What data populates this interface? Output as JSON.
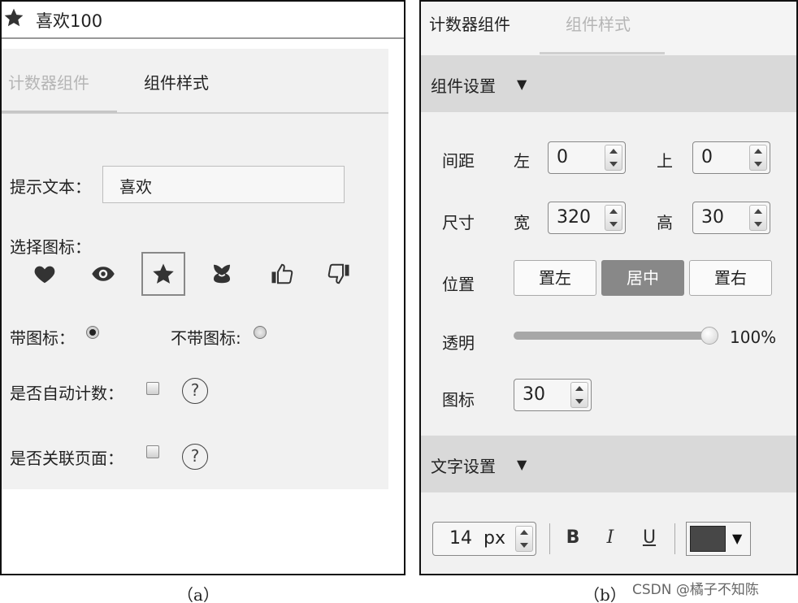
{
  "panel_a": {
    "header": {
      "title": "喜欢100",
      "icon": "star-icon"
    },
    "tabs": [
      {
        "label": "计数器组件",
        "active": true
      },
      {
        "label": "组件样式",
        "active": false
      }
    ],
    "prompt_text": {
      "label": "提示文本：",
      "value": "喜欢"
    },
    "choose_icon": {
      "label": "选择图标：",
      "icons": [
        "heart-icon",
        "eye-icon",
        "star-icon",
        "flower-icon",
        "thumbs-up-icon",
        "thumbs-down-icon"
      ],
      "selected": "star-icon"
    },
    "with_icon": {
      "label": "带图标：",
      "checked": true
    },
    "without_icon": {
      "label": "不带图标:",
      "checked": false
    },
    "auto_count": {
      "label": "是否自动计数：",
      "help": "?"
    },
    "link_page": {
      "label": "是否关联页面：",
      "help": "?"
    }
  },
  "panel_b": {
    "tabs": [
      {
        "label": "计数器组件",
        "active": false
      },
      {
        "label": "组件样式",
        "active": true
      }
    ],
    "component_settings": {
      "title": "组件设置",
      "arrow": "▼",
      "spacing": {
        "label": "间距",
        "left_label": "左",
        "left_value": "0",
        "top_label": "上",
        "top_value": "0"
      },
      "size": {
        "label": "尺寸",
        "width_label": "宽",
        "width_value": "320",
        "height_label": "高",
        "height_value": "30"
      },
      "position": {
        "label": "位置",
        "options": [
          "置左",
          "居中",
          "置右"
        ],
        "selected": "居中"
      },
      "opacity": {
        "label": "透明",
        "value_text": "100%",
        "value": 1.0
      },
      "icon_size": {
        "label": "图标",
        "value": "30"
      }
    },
    "text_settings": {
      "title": "文字设置",
      "arrow": "▼",
      "font_size_value": "14",
      "font_size_unit": "px",
      "bold": "B",
      "italic": "I",
      "underline": "U",
      "color": "#474747",
      "dropdown_arrow": "▼"
    }
  },
  "captions": {
    "a": "（a）",
    "b": "（b）"
  },
  "watermark": "CSDN @橘子不知陈"
}
